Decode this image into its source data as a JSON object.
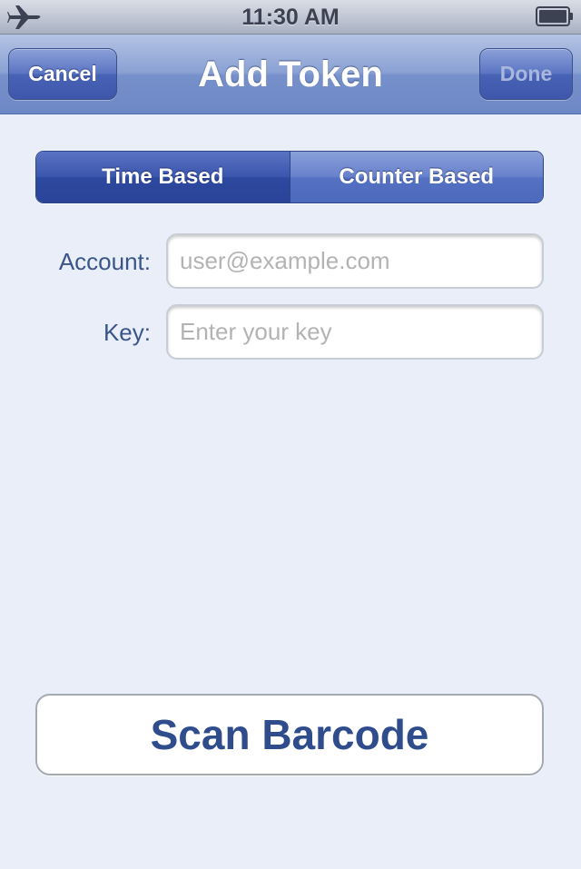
{
  "status_bar": {
    "time": "11:30 AM",
    "left_icon": "airplane-icon",
    "right_icon": "battery-icon"
  },
  "nav_bar": {
    "title": "Add Token",
    "cancel_label": "Cancel",
    "done_label": "Done"
  },
  "segmented": {
    "options": [
      "Time Based",
      "Counter Based"
    ],
    "selected": "Time Based"
  },
  "form": {
    "account": {
      "label": "Account:",
      "value": "",
      "placeholder": "user@example.com"
    },
    "key": {
      "label": "Key:",
      "value": "",
      "placeholder": "Enter your key"
    }
  },
  "scan_button": {
    "label": "Scan Barcode"
  },
  "colors": {
    "background": "#e9eef8",
    "label_blue": "#3a5589",
    "scan_text": "#2f4d8c",
    "nav_blue": "#7690cb"
  }
}
